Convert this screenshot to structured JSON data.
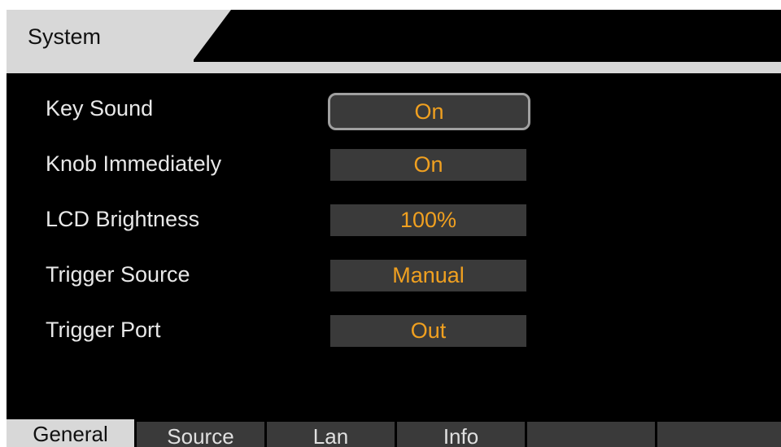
{
  "header": {
    "title": "System"
  },
  "settings": [
    {
      "label": "Key Sound",
      "value": "On",
      "selected": true
    },
    {
      "label": "Knob Immediately",
      "value": "On",
      "selected": false
    },
    {
      "label": "LCD Brightness",
      "value": "100%",
      "selected": false
    },
    {
      "label": "Trigger Source",
      "value": "Manual",
      "selected": false
    },
    {
      "label": "Trigger Port",
      "value": "Out",
      "selected": false
    }
  ],
  "tabs": [
    {
      "label": "General",
      "active": true
    },
    {
      "label": "Source",
      "active": false
    },
    {
      "label": "Lan",
      "active": false
    },
    {
      "label": "Info",
      "active": false
    },
    {
      "label": "",
      "active": false
    },
    {
      "label": "",
      "active": false
    }
  ],
  "colors": {
    "background": "#000000",
    "title_tab": "#d8d8d8",
    "value_box": "#3a3a3a",
    "value_text": "#f0a020",
    "label_text": "#e8e8e8",
    "selection_border": "#a0a0a0"
  }
}
